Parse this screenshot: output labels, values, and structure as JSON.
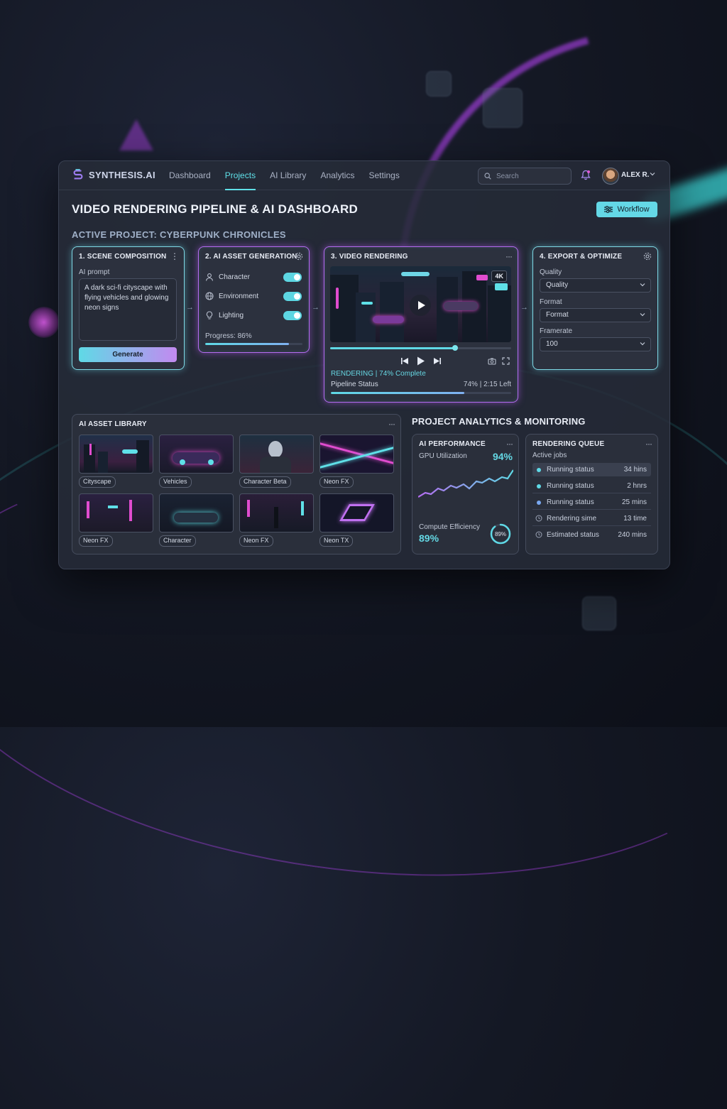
{
  "app": {
    "logo_text": "SYNTHESIS.AI"
  },
  "nav": [
    {
      "label": "Dashboard",
      "active": false
    },
    {
      "label": "Projects",
      "active": true
    },
    {
      "label": "AI Library",
      "active": false
    },
    {
      "label": "Analytics",
      "active": false
    },
    {
      "label": "Settings",
      "active": false
    }
  ],
  "search": {
    "placeholder": "Search"
  },
  "user": {
    "name": "ALEX R."
  },
  "page": {
    "title": "VIDEO RENDERING PIPELINE & AI DASHBOARD",
    "workflow_label": "Workflow",
    "project_title": "ACTIVE PROJECT: CYBERPUNK CHRONICLES"
  },
  "scene": {
    "title": "1. SCENE COMPOSITION",
    "prompt_label": "AI prompt",
    "prompt_text": "A dark sci-fi cityscape with flying vehicles and glowing neon signs",
    "generate_label": "Generate"
  },
  "asset_gen": {
    "title": "2. AI ASSET GENERATION",
    "toggles": [
      {
        "label": "Character",
        "on": true
      },
      {
        "label": "Environment",
        "on": true
      },
      {
        "label": "Lighting",
        "on": true
      }
    ],
    "progress_label": "Progress: 86%",
    "progress": 0.86
  },
  "video": {
    "title": "3. VIDEO RENDERING",
    "badge": "4K",
    "seek": 0.69,
    "status": "RENDERING | 74% Complete",
    "pipeline_label": "Pipeline Status",
    "pipeline_right": "74%  | 2:15 Left",
    "pipeline_progress": 0.74
  },
  "export": {
    "title": "4. EXPORT & OPTIMIZE",
    "quality_label": "Quality",
    "quality_value": "Quality",
    "format_label": "Format",
    "format_value": "Format",
    "framerate_label": "Framerate",
    "framerate_value": "100"
  },
  "library": {
    "title": "AI ASSET LIBRARY",
    "items": [
      {
        "label": "Cityscape"
      },
      {
        "label": "Vehicles"
      },
      {
        "label": "Character Beta"
      },
      {
        "label": "Neon FX"
      },
      {
        "label": "Neon FX"
      },
      {
        "label": "Character"
      },
      {
        "label": "Neon FX"
      },
      {
        "label": "Neon TX"
      }
    ]
  },
  "analytics": {
    "title": "PROJECT ANALYTICS & MONITORING",
    "performance": {
      "title": "AI PERFORMANCE",
      "gpu_label": "GPU Utilization",
      "gpu_value": "94%",
      "compute_label": "Compute Efficiency",
      "compute_value": "89%",
      "gauge_value": "89%",
      "gauge_fraction": 0.89
    },
    "queue": {
      "title": "RENDERING QUEUE",
      "subtitle": "Active jobs",
      "rows": [
        {
          "label": "Running status",
          "value": "34 hins"
        },
        {
          "label": "Running status",
          "value": "2 hnrs"
        },
        {
          "label": "Running status",
          "value": "25 mins"
        },
        {
          "label": "Rendering sime",
          "value": "13 time"
        },
        {
          "label": "Estimated status",
          "value": "240 mins"
        }
      ]
    }
  },
  "colors": {
    "accent_cyan": "#5fd9e6",
    "accent_purple": "#b46cf0"
  }
}
